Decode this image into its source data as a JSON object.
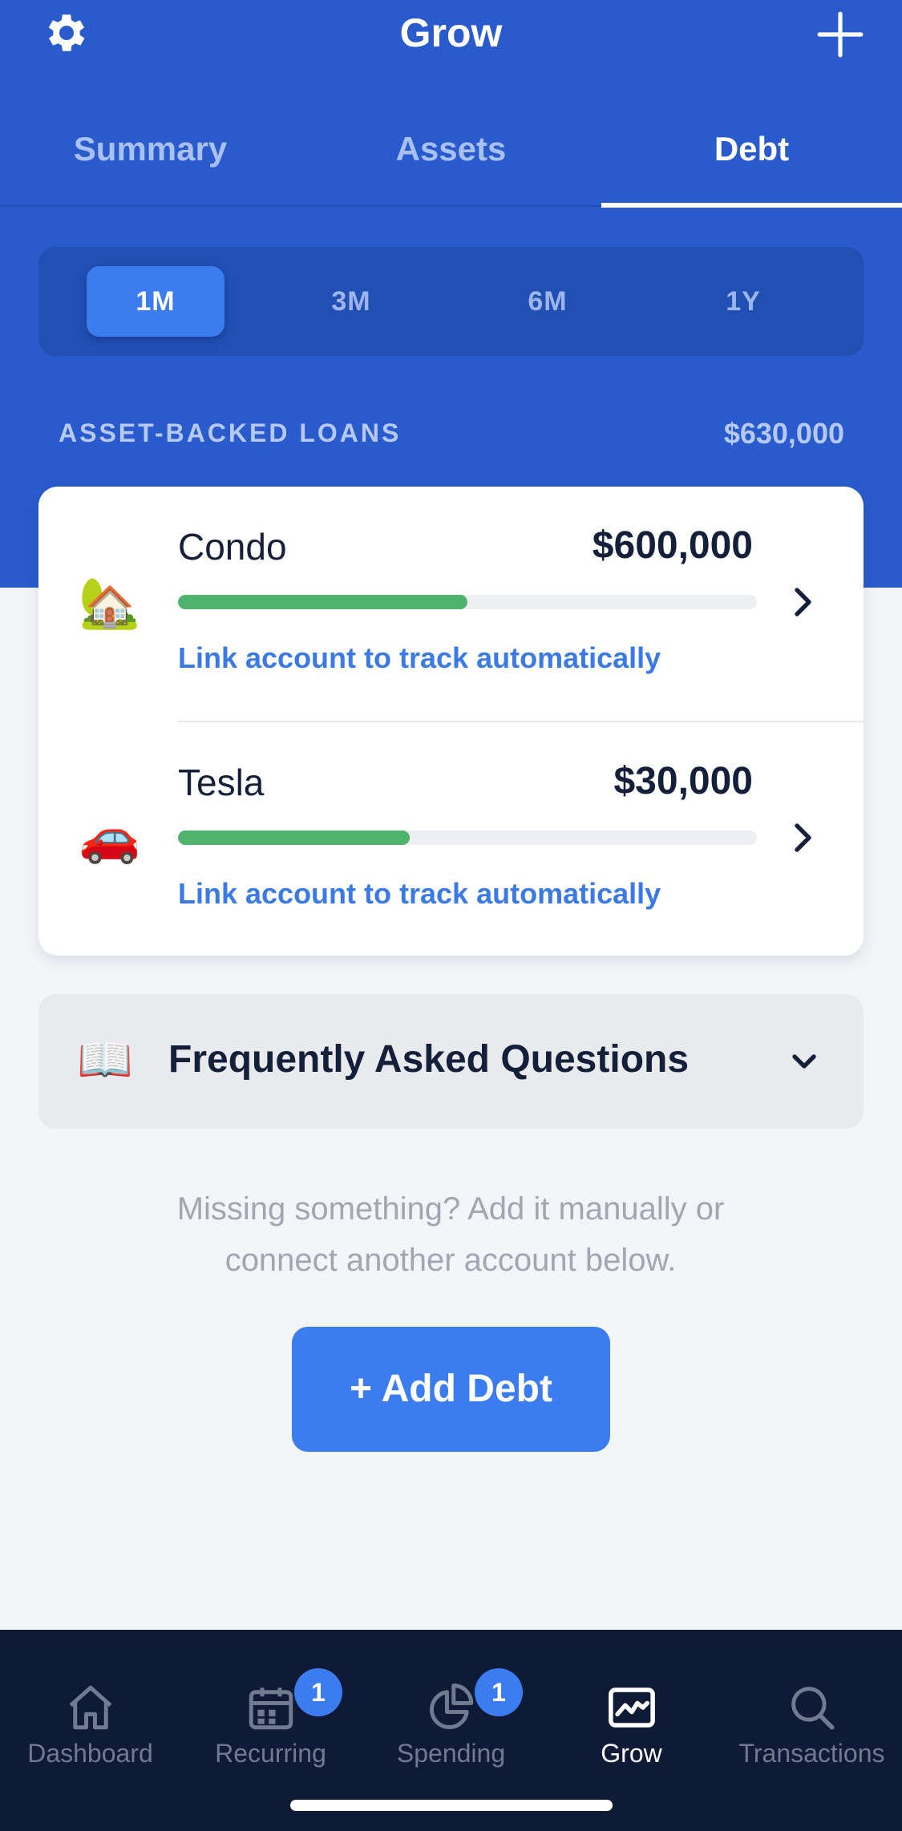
{
  "header": {
    "title": "Grow",
    "settings_icon": "gear-icon",
    "add_icon": "plus-icon"
  },
  "tabs": [
    {
      "label": "Summary",
      "active": false
    },
    {
      "label": "Assets",
      "active": false
    },
    {
      "label": "Debt",
      "active": true
    }
  ],
  "range_selector": {
    "options": [
      "1M",
      "3M",
      "6M",
      "1Y"
    ],
    "selected": "1M"
  },
  "section": {
    "label": "ASSET-BACKED LOANS",
    "total": "$630,000"
  },
  "loans": [
    {
      "emoji": "🏡",
      "name": "Condo",
      "amount": "$600,000",
      "progress": 0.5,
      "link": "Link account to track automatically"
    },
    {
      "emoji": "🚗",
      "name": "Tesla",
      "amount": "$30,000",
      "progress": 0.4,
      "link": "Link account to track automatically"
    }
  ],
  "faq": {
    "icon": "📖",
    "title": "Frequently Asked Questions"
  },
  "missing": {
    "line1": "Missing something? Add it manually or",
    "line2": "connect another account below."
  },
  "add_button": {
    "label": "+ Add Debt"
  },
  "tabbar": [
    {
      "label": "Dashboard",
      "icon": "home-icon",
      "badge": null,
      "active": false
    },
    {
      "label": "Recurring",
      "icon": "calendar-icon",
      "badge": "1",
      "active": false
    },
    {
      "label": "Spending",
      "icon": "pie-chart-icon",
      "badge": "1",
      "active": false
    },
    {
      "label": "Grow",
      "icon": "chart-icon",
      "badge": null,
      "active": true
    },
    {
      "label": "Transactions",
      "icon": "search-icon",
      "badge": null,
      "active": false
    }
  ],
  "colors": {
    "primary_blue": "#2a5bcc",
    "accent_blue": "#3b7cf0",
    "progress_green": "#4fb36c",
    "tabbar_bg": "#0f1a36"
  }
}
